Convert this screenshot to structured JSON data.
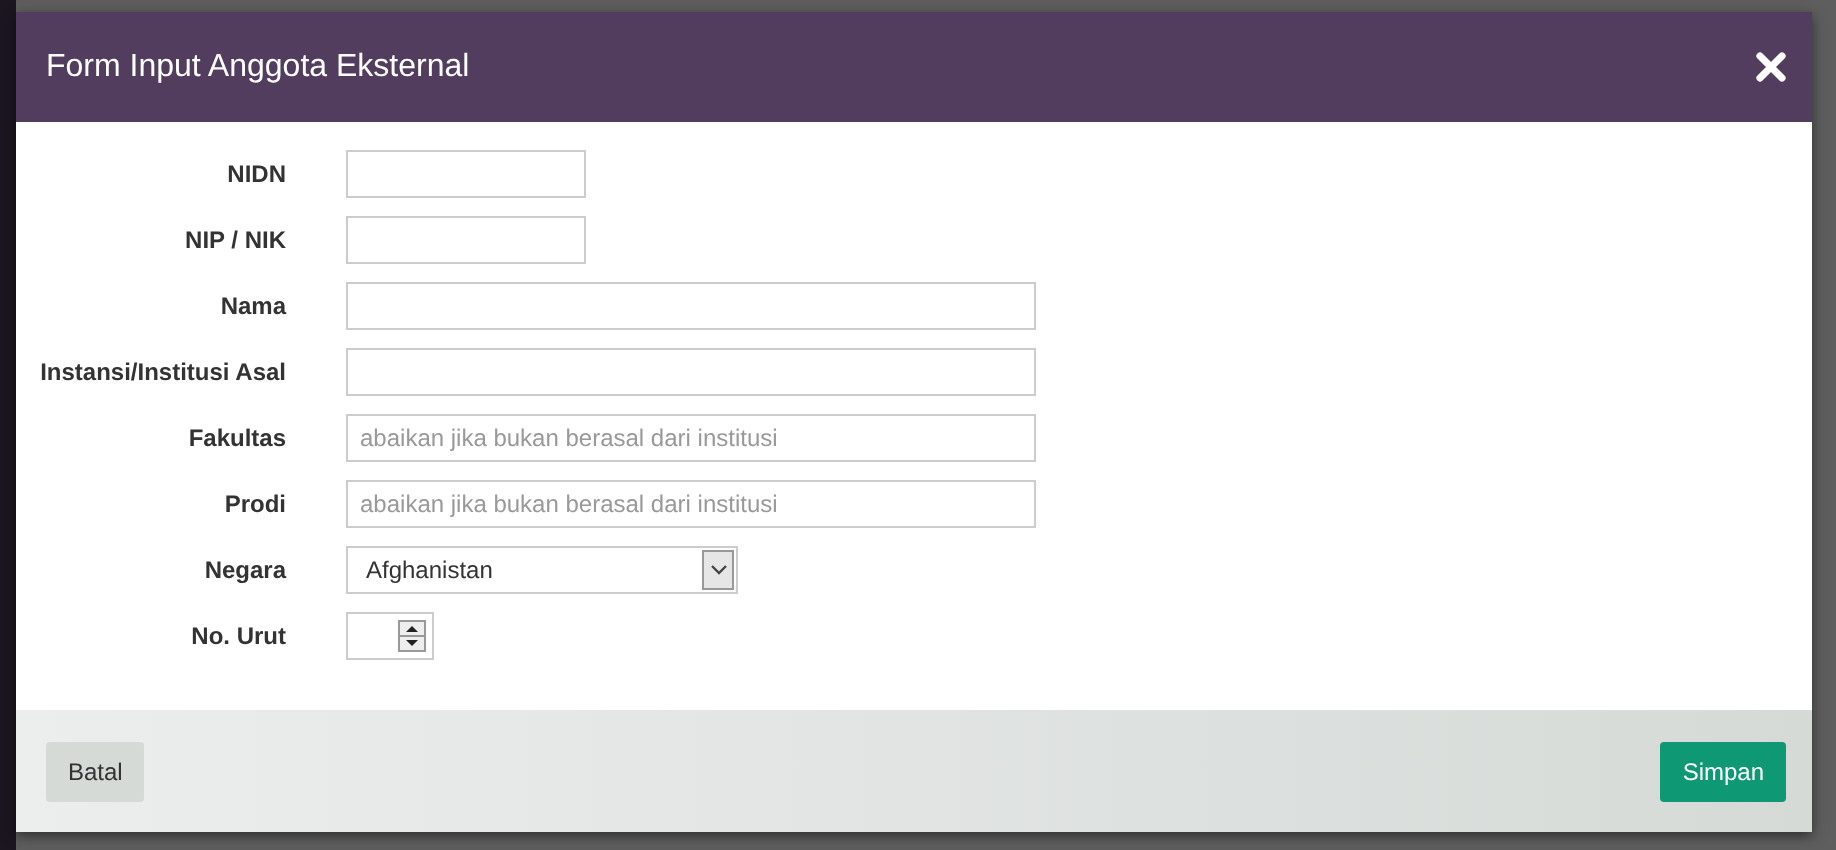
{
  "dialog": {
    "title": "Form Input Anggota Eksternal"
  },
  "fields": [
    {
      "label": "NIDN",
      "kind": "short"
    },
    {
      "label": "NIP / NIK",
      "kind": "short"
    },
    {
      "label": "Nama",
      "kind": "text"
    },
    {
      "label": "Instansi/Institusi Asal",
      "kind": "text"
    },
    {
      "label": "Fakultas",
      "kind": "text",
      "placeholder": "abaikan jika bukan berasal dari institusi"
    },
    {
      "label": "Prodi",
      "kind": "text",
      "placeholder": "abaikan jika bukan berasal dari institusi"
    },
    {
      "label": "Negara",
      "kind": "select",
      "value": "Afghanistan"
    },
    {
      "label": "No. Urut",
      "kind": "number"
    }
  ],
  "buttons": [
    {
      "label": "Batal",
      "kind": "secondary"
    },
    {
      "label": "Simpan",
      "kind": "primary"
    }
  ]
}
